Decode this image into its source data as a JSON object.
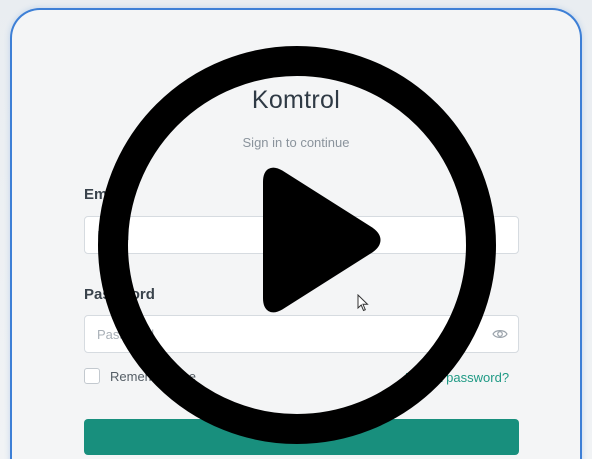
{
  "app": {
    "title": "Komtrol",
    "subtitle": "Sign in to continue"
  },
  "form": {
    "email_label": "Email",
    "email_placeholder": "Email",
    "password_label": "Password",
    "password_placeholder": "Password",
    "remember_label": "Remember me",
    "forgot_label": "Forgot password?",
    "submit_label": ""
  },
  "colors": {
    "card_border": "#3d7fd6",
    "accent": "#188f7d",
    "link": "#1f9a85",
    "overlay": "#000000"
  },
  "icons": {
    "password_toggle": "eye-icon",
    "overlay": "play-icon",
    "pointer": "mouse-cursor-icon"
  }
}
